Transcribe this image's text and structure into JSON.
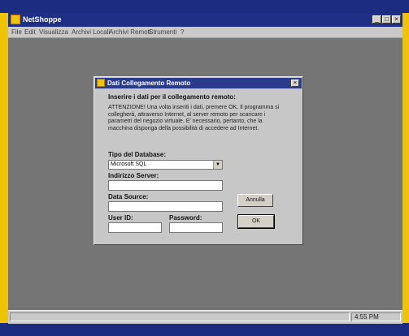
{
  "app": {
    "title": "NetShoppe",
    "window_buttons": [
      "_",
      "□",
      "×"
    ]
  },
  "menubar": {
    "items": [
      "File",
      "Edit",
      "Visualizza",
      "Archivi Locali",
      "Archivi Remoti",
      "Strumenti",
      "?"
    ]
  },
  "statusbar": {
    "time": "4:55 PM"
  },
  "dialog": {
    "title": "Dati Collegamento Remoto",
    "close": "×",
    "heading": "Inserire i dati per il collegamento remoto:",
    "warning": "ATTENZIONE! Una volta inseriti i dati, premere OK. Il programma si collegherà, attraverso Internet, al server remoto per scaricare i parametri del negozio virtuale. E' necessario, pertanto, che la macchina disponga della possibilità di accedere ad Internet.",
    "db_type_label": "Tipo del Database:",
    "db_type_value": "Microsoft SQL",
    "server_label": "Indirizzo Server:",
    "server_value": "",
    "datasource_label": "Data Source:",
    "datasource_value": "",
    "userid_label": "User ID:",
    "userid_value": "",
    "password_label": "Password:",
    "password_value": "",
    "cancel_label": "Annulla",
    "ok_label": "OK"
  },
  "colors": {
    "frame_blue": "#1c2c80",
    "frame_yellow": "#f0c400",
    "desktop_gray": "#757575",
    "dialog_gray": "#c7c7c7"
  }
}
